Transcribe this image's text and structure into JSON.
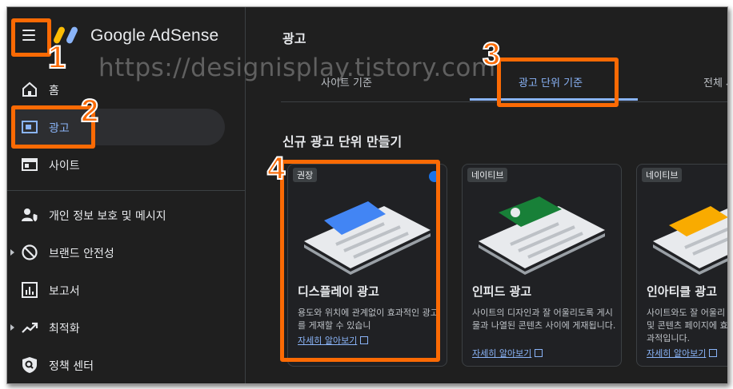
{
  "app": {
    "logo_text": "Google AdSense"
  },
  "watermark": "https://designisplay.tistory.com",
  "sidebar": {
    "items": [
      {
        "label": "홈",
        "icon": "home-icon"
      },
      {
        "label": "광고",
        "icon": "ads-icon",
        "active": true
      },
      {
        "label": "사이트",
        "icon": "sites-icon"
      },
      {
        "label": "개인 정보 보호 및 메시지",
        "icon": "privacy-icon"
      },
      {
        "label": "브랜드 안전성",
        "icon": "block-icon",
        "expandable": true
      },
      {
        "label": "보고서",
        "icon": "reports-icon"
      },
      {
        "label": "최적화",
        "icon": "trending-icon",
        "expandable": true
      },
      {
        "label": "정책 센터",
        "icon": "policy-icon"
      }
    ]
  },
  "main": {
    "page_title": "광고",
    "tabs": [
      {
        "label": "사이트 기준"
      },
      {
        "label": "광고 단위 기준",
        "active": true
      },
      {
        "label": "전체 사"
      }
    ],
    "section_title": "신규 광고 단위 만들기",
    "cards": [
      {
        "chip": "권장",
        "title": "디스플레이 광고",
        "desc": "용도와 위치에 관계없이 효과적인 광고를 게재할 수 있습니",
        "link": "자세히 알아보기",
        "accent": "#4285f4"
      },
      {
        "chip": "네이티브",
        "title": "인피드 광고",
        "desc": "사이트의 디자인과 잘 어울리도록 게시물과 나열된 콘텐츠 사이에 게재됩니다.",
        "link": "자세히 알아보기",
        "accent": "#188038"
      },
      {
        "chip": "네이티브",
        "title": "인아티클 광고",
        "desc": "사이트와도 잘 어울리 및 콘텐츠 페이지에 효과적입니다.",
        "link": "자세히 알아보기",
        "accent": "#f9ab00"
      }
    ]
  },
  "annotations": {
    "n1": "1",
    "n2": "2",
    "n3": "3",
    "n4": "4",
    "color": "#fb6a04"
  }
}
